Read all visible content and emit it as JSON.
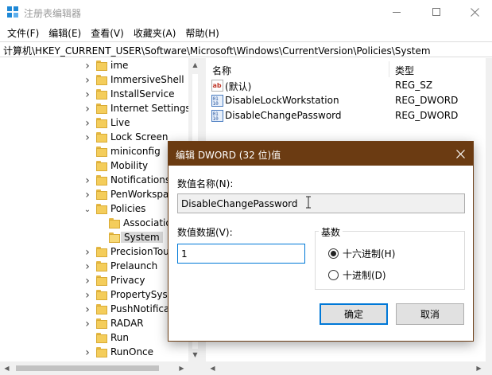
{
  "window": {
    "title": "注册表编辑器",
    "minimize_icon": "minimize-icon",
    "maximize_icon": "maximize-icon",
    "close_icon": "close-icon"
  },
  "menu": [
    "文件(F)",
    "编辑(E)",
    "查看(V)",
    "收藏夹(A)",
    "帮助(H)"
  ],
  "address": "计算机\\HKEY_CURRENT_USER\\Software\\Microsoft\\Windows\\CurrentVersion\\Policies\\System",
  "tree": {
    "items": [
      {
        "label": "ime",
        "expander": "chevron-right"
      },
      {
        "label": "ImmersiveShell",
        "expander": "chevron-right"
      },
      {
        "label": "InstallService",
        "expander": "chevron-right"
      },
      {
        "label": "Internet Settings",
        "expander": "chevron-right"
      },
      {
        "label": "Live",
        "expander": "chevron-right"
      },
      {
        "label": "Lock Screen",
        "expander": "chevron-right"
      },
      {
        "label": "miniconfig",
        "expander": "none"
      },
      {
        "label": "Mobility",
        "expander": "none"
      },
      {
        "label": "Notifications",
        "expander": "chevron-right"
      },
      {
        "label": "PenWorkspace",
        "expander": "chevron-right"
      },
      {
        "label": "Policies",
        "expander": "chevron-down"
      },
      {
        "label": "Associations",
        "expander": "none"
      },
      {
        "label": "System",
        "expander": "none",
        "selected": true
      },
      {
        "label": "PrecisionTouchPad",
        "expander": "chevron-right"
      },
      {
        "label": "Prelaunch",
        "expander": "chevron-right"
      },
      {
        "label": "Privacy",
        "expander": "chevron-right"
      },
      {
        "label": "PropertySystem",
        "expander": "chevron-right"
      },
      {
        "label": "PushNotifications",
        "expander": "chevron-right"
      },
      {
        "label": "RADAR",
        "expander": "chevron-right"
      },
      {
        "label": "Run",
        "expander": "none"
      },
      {
        "label": "RunOnce",
        "expander": "chevron-right"
      }
    ]
  },
  "list": {
    "columns": [
      "名称",
      "类型"
    ],
    "rows": [
      {
        "name": "(默认)",
        "type": "REG_SZ",
        "icon": "string-value-icon"
      },
      {
        "name": "DisableLockWorkstation",
        "type": "REG_DWORD",
        "icon": "dword-value-icon"
      },
      {
        "name": "DisableChangePassword",
        "type": "REG_DWORD",
        "icon": "dword-value-icon"
      }
    ]
  },
  "dialog": {
    "title": "编辑 DWORD (32 位)值",
    "value_name_label": "数值名称(N):",
    "value_name": "DisableChangePassword",
    "value_data_label": "数值数据(V):",
    "value_data": "1",
    "base_label": "基数",
    "hex_label": "十六进制(H)",
    "dec_label": "十进制(D)",
    "base_selected": "hex",
    "ok_label": "确定",
    "cancel_label": "取消"
  },
  "colors": {
    "dialog_titlebar": "#6b3b12",
    "folder": "#f4cd5b",
    "focus_border": "#0078d7"
  }
}
